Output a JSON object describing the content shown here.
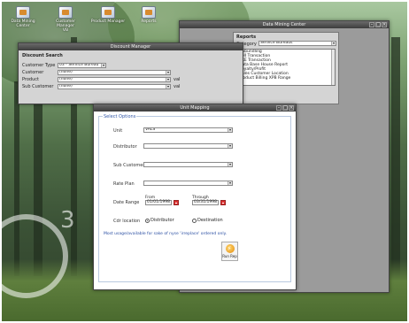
{
  "desktop": {
    "icons": [
      {
        "label": "Data Mining Center",
        "icon": "data-mining-icon"
      },
      {
        "label": "Customer Manager",
        "icon": "customer-manager-icon"
      },
      {
        "label": "Product Manager",
        "icon": "product-manager-icon"
      },
      {
        "label": "Reports",
        "icon": "reports-icon"
      }
    ],
    "sub_label": "VB",
    "ring_number": "3"
  },
  "discount_window": {
    "title": "Discount Manager",
    "section_title": "Discount Search",
    "fields": [
      {
        "label": "Customer Type",
        "value": "03 - Service Bureau"
      },
      {
        "label": "Customer",
        "value": "(none)"
      },
      {
        "label": "Product",
        "value": "(none)"
      },
      {
        "label": "Sub Customer",
        "value": "(none)"
      }
    ],
    "side_labels": [
      "val",
      "val"
    ]
  },
  "data_mining_window": {
    "title": "Data Mining Center",
    "section_title": "Reports",
    "category_label": "Category",
    "category_value": "Service Bureaus",
    "reports": [
      "Unbundling",
      "NHI Transaction",
      "PRE Transaction",
      "Data Base House Report",
      "Royalty/Profit",
      "Sales Customer Location",
      "Product Billing XPB Range"
    ]
  },
  "usage_dialog": {
    "title": "Unit Mapping",
    "legend": "Select Options",
    "fields": {
      "unit_label": "Unit",
      "unit_value": "VALS",
      "distributor_label": "Distributor",
      "sub_customer_label": "Sub Customer",
      "rate_plan_label": "Rate Plan",
      "date_range_label": "Date Range",
      "from_label": "From",
      "from_value": "01/01/1998",
      "through_label": "Through",
      "through_value": "03/31/1998",
      "cdr_location_label": "Cdr location",
      "radio_distributor": "Distributor",
      "radio_destination": "Destination"
    },
    "note": "Most usage/available for sake of nyse 'irreplace' ordered only.",
    "run_label": "Run Rep"
  }
}
